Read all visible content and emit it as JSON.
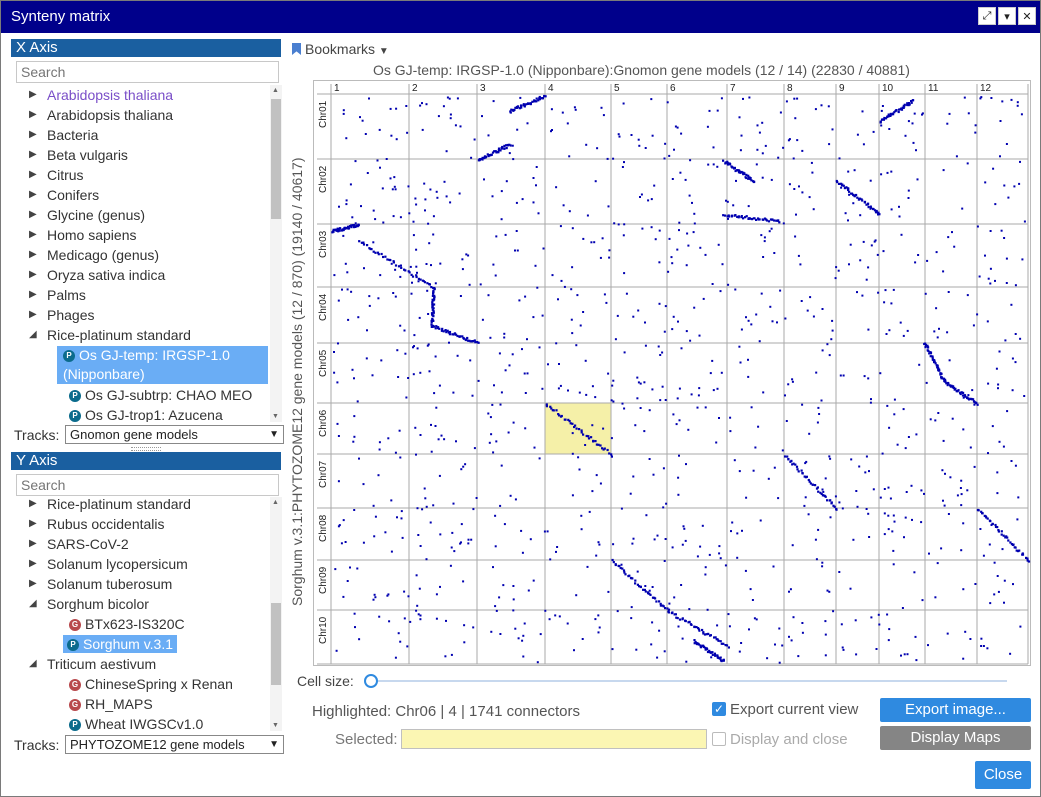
{
  "window": {
    "title": "Synteny matrix"
  },
  "x_axis": {
    "header": "X Axis",
    "search_placeholder": "Search",
    "tree": [
      {
        "label": "Arabidopsis thaliana",
        "type": "folder",
        "hover": true
      },
      {
        "label": "Arabidopsis thaliana",
        "type": "folder"
      },
      {
        "label": "Bacteria",
        "type": "folder"
      },
      {
        "label": "Beta vulgaris",
        "type": "folder"
      },
      {
        "label": "Citrus",
        "type": "folder"
      },
      {
        "label": "Conifers",
        "type": "folder"
      },
      {
        "label": "Glycine (genus)",
        "type": "folder"
      },
      {
        "label": "Homo sapiens",
        "type": "folder"
      },
      {
        "label": "Medicago (genus)",
        "type": "folder"
      },
      {
        "label": "Oryza sativa indica",
        "type": "folder"
      },
      {
        "label": "Palms",
        "type": "folder"
      },
      {
        "label": "Phages",
        "type": "folder"
      },
      {
        "label": "Rice-platinum standard",
        "type": "folder-open"
      }
    ],
    "selected_line1": "Os GJ-temp: IRGSP-1.0",
    "selected_line2": "(Nipponbare)",
    "children": [
      {
        "label": "Os GJ-subtrp: CHAO MEO",
        "badge": "P"
      },
      {
        "label": "Os GJ-trop1: Azucena",
        "badge": "P"
      }
    ],
    "tracks_label": "Tracks:",
    "tracks_value": "Gnomon gene models"
  },
  "y_axis": {
    "header": "Y Axis",
    "search_placeholder": "Search",
    "tree": [
      {
        "label": "Rice-platinum standard",
        "type": "folder"
      },
      {
        "label": "Rubus occidentalis",
        "type": "folder"
      },
      {
        "label": "SARS-CoV-2",
        "type": "folder"
      },
      {
        "label": "Solanum lycopersicum",
        "type": "folder"
      },
      {
        "label": "Solanum tuberosum",
        "type": "folder"
      },
      {
        "label": "Sorghum bicolor",
        "type": "folder-open"
      },
      {
        "label": "BTx623-IS320C",
        "type": "leaf",
        "badge": "G"
      },
      {
        "label": "Sorghum v.3.1",
        "type": "leaf",
        "badge": "P",
        "selected": true
      },
      {
        "label": "Triticum aestivum",
        "type": "folder-open"
      },
      {
        "label": "ChineseSpring x Renan",
        "type": "leaf",
        "badge": "G"
      },
      {
        "label": "RH_MAPS",
        "type": "leaf",
        "badge": "G"
      },
      {
        "label": "Wheat IWGSCv1.0",
        "type": "leaf",
        "badge": "P"
      }
    ],
    "tracks_label": "Tracks:",
    "tracks_value": "PHYTOZOME12 gene models"
  },
  "bookmarks_label": "Bookmarks",
  "matrix": {
    "title": "Os GJ-temp: IRGSP-1.0 (Nipponbare):Gnomon gene models (12 / 14) (22830 / 40881)",
    "y_title": "Sorghum v.3.1:PHYTOZOME12 gene models (12 / 870) (19140 / 40617)",
    "x_cols": [
      "1",
      "2",
      "3",
      "4",
      "5",
      "6",
      "7",
      "8",
      "9",
      "10",
      "11",
      "12"
    ],
    "y_rows": [
      "Chr01",
      "Chr02",
      "Chr03",
      "Chr04",
      "Chr05",
      "Chr06",
      "Chr07",
      "Chr08",
      "Chr09",
      "Chr10"
    ],
    "highlight": {
      "col": "4",
      "row": "Chr06"
    },
    "dot_color": "#0000b0",
    "highlight_color": "#f5f0a8"
  },
  "cell_size": {
    "label": "Cell size:",
    "value": 0
  },
  "highlighted_text": "Highlighted: Chr06 | 4 | 1741 connectors",
  "export_current_view": {
    "label": "Export current view",
    "checked": true
  },
  "export_button": "Export image...",
  "selected_label": "Selected:",
  "selected_value": "",
  "display_and_close": {
    "label": "Display and close",
    "checked": false
  },
  "display_maps_button": "Display Maps",
  "close_button": "Close"
}
